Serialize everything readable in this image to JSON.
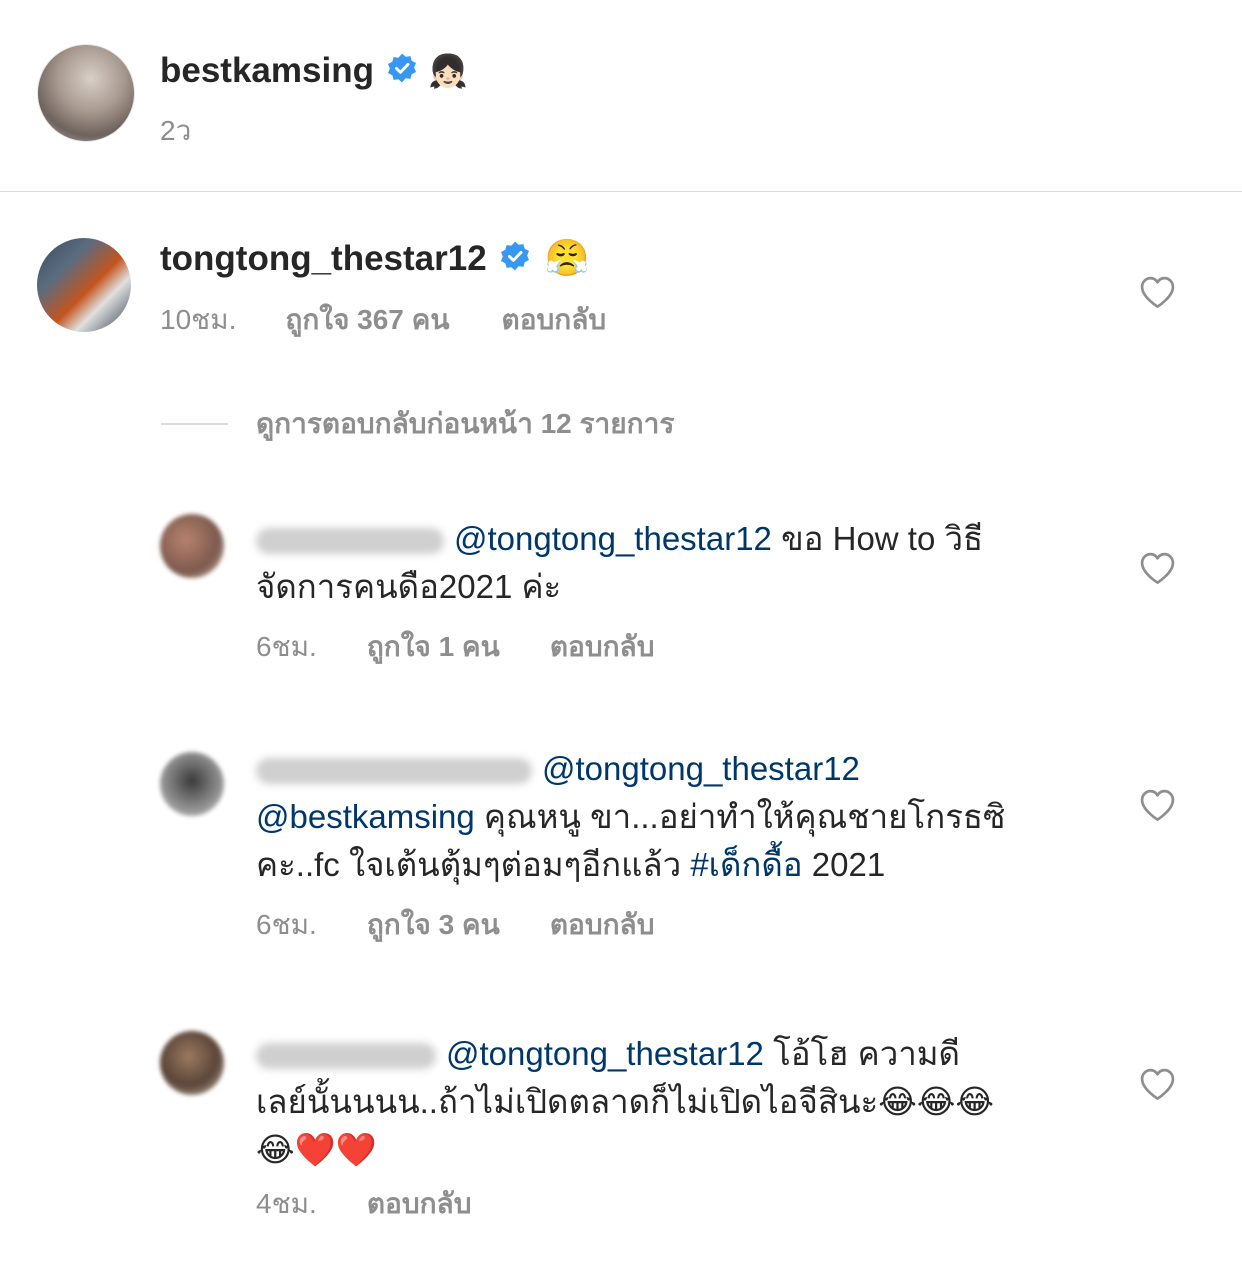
{
  "post": {
    "username": "bestkamsing",
    "emoji": "👧🏻",
    "time": "2ว"
  },
  "main_comment": {
    "username": "tongtong_thestar12",
    "emoji": "😤",
    "time": "10ชม.",
    "likes": "ถูกใจ 367 คน",
    "reply": "ตอบกลับ"
  },
  "view_replies": "ดูการตอบกลับก่อนหน้า 12 รายการ",
  "replies": [
    {
      "mention": "@tongtong_thestar12",
      "text_a": " ขอ How to วิธี",
      "text_b": "จัดการคนดือ2021 ค่ะ",
      "time": "6ชม.",
      "likes": "ถูกใจ 1 คน",
      "reply": "ตอบกลับ"
    },
    {
      "mention": "@tongtong_thestar12",
      "mention2": "@bestkamsing",
      "text_a": " คุณหนู ขา...อย่าทำให้คุณชายโกรธซิ",
      "text_b": "คะ..fc ใจเต้นตุ้มๆต่อมๆอีกแล้ว ",
      "hashtag": "#เด็กดื้อ",
      "text_c": " 2021",
      "time": "6ชม.",
      "likes": "ถูกใจ 3 คน",
      "reply": "ตอบกลับ"
    },
    {
      "mention": "@tongtong_thestar12",
      "text_a": " โอ้โฮ ความดี",
      "text_b": "เลย์นั้นนนน..ถ้าไม่เปิดตลาดก็ไม่เปิดไอจีสินะ😂😂😂",
      "text_c": "😂❤️❤️",
      "time": "4ชม.",
      "reply": "ตอบกลับ"
    }
  ],
  "colors": {
    "text": "#262626",
    "muted": "#8e8e8e",
    "link": "#00376b",
    "verified": "#3897f0",
    "divider": "#dbdbdb"
  }
}
